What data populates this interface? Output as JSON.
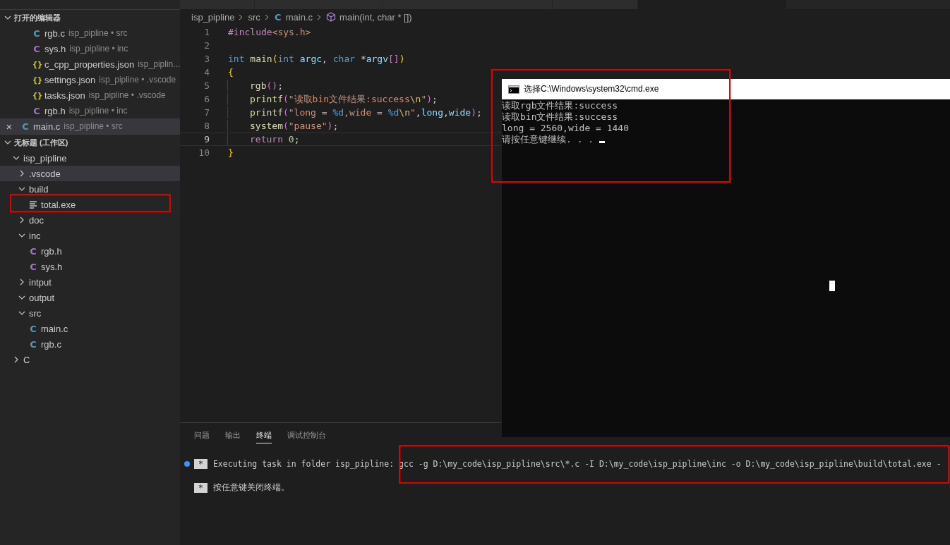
{
  "sidebar": {
    "open_editors": {
      "title": "打开的编辑器",
      "expanded": true,
      "items": [
        {
          "icon": "C",
          "name": "rgb.c",
          "path": "isp_pipline • src",
          "kind": "c",
          "selected": false
        },
        {
          "icon": "C",
          "name": "sys.h",
          "path": "isp_pipline • inc",
          "kind": "h",
          "selected": false
        },
        {
          "icon": "{}",
          "name": "c_cpp_properties.json",
          "path": "isp_piplin...",
          "kind": "json",
          "selected": false
        },
        {
          "icon": "{}",
          "name": "settings.json",
          "path": "isp_pipline • .vscode",
          "kind": "json",
          "selected": false
        },
        {
          "icon": "{}",
          "name": "tasks.json",
          "path": "isp_pipline • .vscode",
          "kind": "json",
          "selected": false
        },
        {
          "icon": "C",
          "name": "rgb.h",
          "path": "isp_pipline • inc",
          "kind": "h",
          "selected": false
        },
        {
          "icon": "C",
          "name": "main.c",
          "path": "isp_pipline • src",
          "kind": "c",
          "selected": true,
          "close": "×"
        }
      ]
    },
    "workspace": {
      "title": "无标题 (工作区)",
      "expanded": true,
      "tree": [
        {
          "name": "isp_pipline",
          "kind": "folder",
          "expanded": true,
          "children": [
            {
              "name": ".vscode",
              "kind": "folder",
              "expanded": false,
              "selected": true
            },
            {
              "name": "build",
              "kind": "folder",
              "expanded": true,
              "children": [
                {
                  "name": "total.exe",
                  "kind": "text",
                  "highlighted": true
                }
              ]
            },
            {
              "name": "doc",
              "kind": "folder",
              "expanded": false
            },
            {
              "name": "inc",
              "kind": "folder",
              "expanded": true,
              "children": [
                {
                  "icon": "C",
                  "name": "rgb.h",
                  "kind": "h"
                },
                {
                  "icon": "C",
                  "name": "sys.h",
                  "kind": "h"
                }
              ]
            },
            {
              "name": "intput",
              "kind": "folder",
              "expanded": false
            },
            {
              "name": "output",
              "kind": "folder",
              "expanded": true
            },
            {
              "name": "src",
              "kind": "folder",
              "expanded": true,
              "children": [
                {
                  "icon": "C",
                  "name": "main.c",
                  "kind": "c"
                },
                {
                  "icon": "C",
                  "name": "rgb.c",
                  "kind": "c"
                }
              ]
            }
          ]
        },
        {
          "name": "C",
          "kind": "folder",
          "expanded": false
        }
      ]
    }
  },
  "breadcrumbs": [
    {
      "label": "isp_pipline",
      "kind": "folder"
    },
    {
      "label": "src",
      "kind": "folder"
    },
    {
      "icon": "C",
      "label": "main.c",
      "kind": "c"
    },
    {
      "label": "main(int, char * [])",
      "kind": "symbol"
    }
  ],
  "editor": {
    "lines": [
      {
        "number": "1",
        "tokens": [
          {
            "t": "#include",
            "kind": "pre"
          },
          {
            "t": "<sys.h>",
            "kind": "str"
          }
        ]
      },
      {
        "number": "2"
      },
      {
        "number": "3",
        "tokens": [
          {
            "t": "int ",
            "kind": "kw"
          },
          {
            "t": "main",
            "kind": "fn"
          },
          {
            "t": "(",
            "kind": "b1"
          },
          {
            "t": "int ",
            "kind": "kw"
          },
          {
            "t": "argc",
            "kind": "var"
          },
          {
            "t": ", ",
            "kind": "txt"
          },
          {
            "t": "char ",
            "kind": "kw"
          },
          {
            "t": "*",
            "kind": "txt"
          },
          {
            "t": "argv",
            "kind": "var"
          },
          {
            "t": "[]",
            "kind": "b2"
          },
          {
            "t": ")",
            "kind": "b1"
          }
        ]
      },
      {
        "number": "4",
        "tokens": [
          {
            "t": "{",
            "kind": "b1"
          }
        ]
      },
      {
        "number": "5",
        "indented": true,
        "tokens": [
          {
            "t": "rgb",
            "kind": "fn"
          },
          {
            "t": "()",
            "kind": "b2"
          },
          {
            "t": ";",
            "kind": "txt"
          }
        ]
      },
      {
        "number": "6",
        "indented": true,
        "tokens": [
          {
            "t": "printf",
            "kind": "fn"
          },
          {
            "t": "(",
            "kind": "b2"
          },
          {
            "t": "\"读取bin文件结果:success",
            "kind": "str"
          },
          {
            "t": "\\n",
            "kind": "esc"
          },
          {
            "t": "\"",
            "kind": "str"
          },
          {
            "t": ")",
            "kind": "b2"
          },
          {
            "t": ";",
            "kind": "txt"
          }
        ]
      },
      {
        "number": "7",
        "indented": true,
        "tokens": [
          {
            "t": "printf",
            "kind": "fn"
          },
          {
            "t": "(",
            "kind": "b2"
          },
          {
            "t": "\"long = ",
            "kind": "str"
          },
          {
            "t": "%d",
            "kind": "kw"
          },
          {
            "t": ",wide = ",
            "kind": "str"
          },
          {
            "t": "%d",
            "kind": "kw"
          },
          {
            "t": "\\n",
            "kind": "esc"
          },
          {
            "t": "\"",
            "kind": "str"
          },
          {
            "t": ",",
            "kind": "txt"
          },
          {
            "t": "long",
            "kind": "var"
          },
          {
            "t": ",",
            "kind": "txt"
          },
          {
            "t": "wide",
            "kind": "var"
          },
          {
            "t": ")",
            "kind": "b2"
          },
          {
            "t": ";",
            "kind": "txt"
          }
        ]
      },
      {
        "number": "8",
        "indented": true,
        "tokens": [
          {
            "t": "system",
            "kind": "fn"
          },
          {
            "t": "(",
            "kind": "b2"
          },
          {
            "t": "\"pause\"",
            "kind": "str"
          },
          {
            "t": ")",
            "kind": "b2"
          },
          {
            "t": ";",
            "kind": "txt"
          }
        ]
      },
      {
        "number": "9",
        "indented": true,
        "current": true,
        "tokens": [
          {
            "t": "return ",
            "kind": "ctrl"
          },
          {
            "t": "0",
            "kind": "num"
          },
          {
            "t": ";",
            "kind": "txt"
          }
        ]
      },
      {
        "number": "10",
        "tokens": [
          {
            "t": "}",
            "kind": "b1"
          }
        ]
      }
    ]
  },
  "console_window": {
    "title": "选择C:\\Windows\\system32\\cmd.exe",
    "highlighted": true,
    "lines": [
      "读取rgb文件结果:success",
      "读取bin文件结果:success",
      "long = 2560,wide = 1440",
      "请按任意键继续. . . "
    ]
  },
  "panel": {
    "tabs": [
      {
        "label": "问题",
        "selected": false
      },
      {
        "label": "输出",
        "selected": false
      },
      {
        "label": "终端",
        "selected": true
      },
      {
        "label": "调试控制台",
        "selected": false
      }
    ],
    "terminal": [
      {
        "marker": "*",
        "dot": true,
        "text": "Executing task in folder isp_pipline: ",
        "command": "gcc -g D:\\my_code\\isp_pipline\\src\\*.c -I D:\\my_code\\isp_pipline\\inc -o D:\\my_code\\isp_pipline\\build\\total.exe -",
        "highlighted": true
      },
      {
        "marker": "*",
        "text": "按任意键关闭终端。"
      }
    ]
  }
}
